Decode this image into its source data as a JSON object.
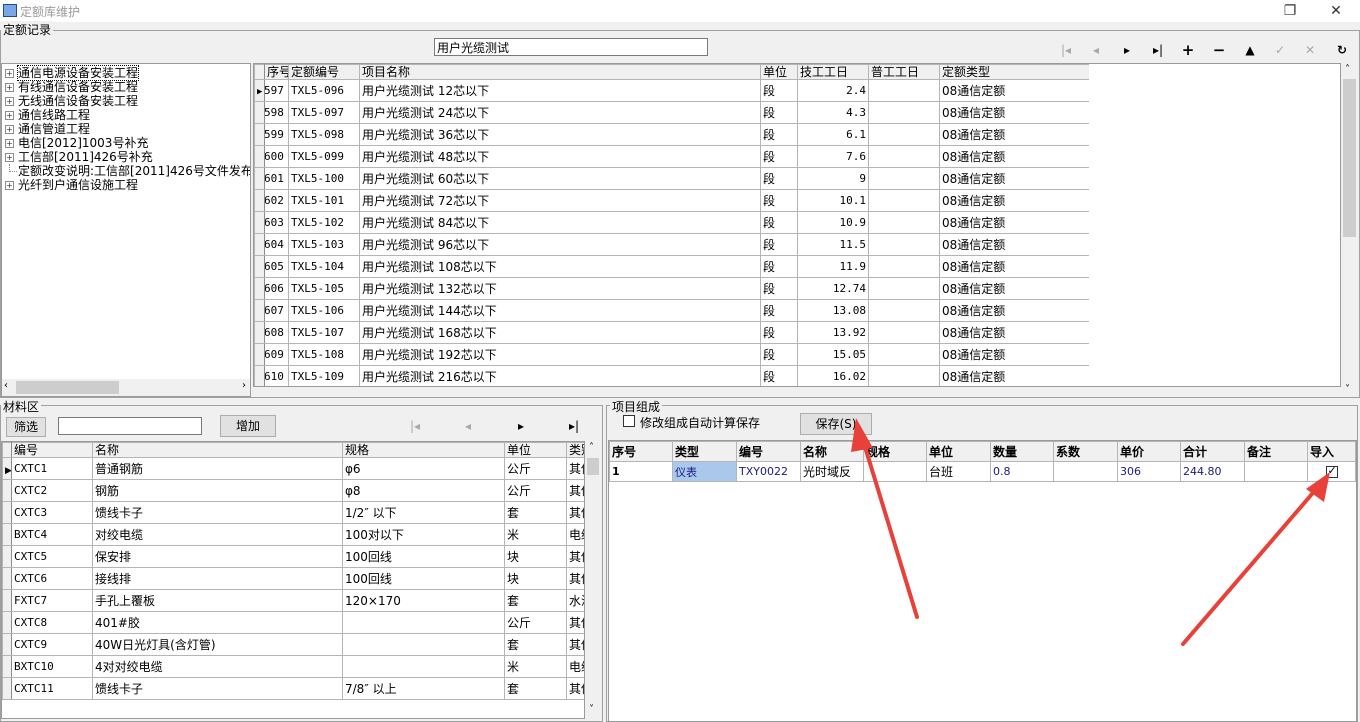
{
  "window": {
    "title": "定额库维护"
  },
  "quota": {
    "group_label": "定额记录",
    "search_value": "用户光缆测试",
    "tree": [
      {
        "label": "通信电源设备安装工程",
        "expander": "+"
      },
      {
        "label": "有线通信设备安装工程",
        "expander": "+"
      },
      {
        "label": "无线通信设备安装工程",
        "expander": "+"
      },
      {
        "label": "通信线路工程",
        "expander": "+"
      },
      {
        "label": "通信管道工程",
        "expander": "+"
      },
      {
        "label": "电信[2012]1003号补充",
        "expander": "+"
      },
      {
        "label": "工信部[2011]426号补充",
        "expander": "+"
      },
      {
        "label": "定额改变说明:工信部[2011]426号文件发布",
        "expander": ""
      },
      {
        "label": "光纤到户通信设施工程",
        "expander": "+"
      }
    ],
    "columns": [
      "序号",
      "定额编号",
      "项目名称",
      "单位",
      "技工工日",
      "普工工日",
      "定额类型"
    ],
    "rows": [
      {
        "seq": "597",
        "code": "TXL5-096",
        "name": "用户光缆测试 12芯以下",
        "unit": "段",
        "skilled": "2.4",
        "general": "",
        "type": "08通信定额"
      },
      {
        "seq": "598",
        "code": "TXL5-097",
        "name": "用户光缆测试 24芯以下",
        "unit": "段",
        "skilled": "4.3",
        "general": "",
        "type": "08通信定额"
      },
      {
        "seq": "599",
        "code": "TXL5-098",
        "name": "用户光缆测试 36芯以下",
        "unit": "段",
        "skilled": "6.1",
        "general": "",
        "type": "08通信定额"
      },
      {
        "seq": "600",
        "code": "TXL5-099",
        "name": "用户光缆测试 48芯以下",
        "unit": "段",
        "skilled": "7.6",
        "general": "",
        "type": "08通信定额"
      },
      {
        "seq": "601",
        "code": "TXL5-100",
        "name": "用户光缆测试 60芯以下",
        "unit": "段",
        "skilled": "9",
        "general": "",
        "type": "08通信定额"
      },
      {
        "seq": "602",
        "code": "TXL5-101",
        "name": "用户光缆测试 72芯以下",
        "unit": "段",
        "skilled": "10.1",
        "general": "",
        "type": "08通信定额"
      },
      {
        "seq": "603",
        "code": "TXL5-102",
        "name": "用户光缆测试 84芯以下",
        "unit": "段",
        "skilled": "10.9",
        "general": "",
        "type": "08通信定额"
      },
      {
        "seq": "604",
        "code": "TXL5-103",
        "name": "用户光缆测试 96芯以下",
        "unit": "段",
        "skilled": "11.5",
        "general": "",
        "type": "08通信定额"
      },
      {
        "seq": "605",
        "code": "TXL5-104",
        "name": "用户光缆测试 108芯以下",
        "unit": "段",
        "skilled": "11.9",
        "general": "",
        "type": "08通信定额"
      },
      {
        "seq": "606",
        "code": "TXL5-105",
        "name": "用户光缆测试 132芯以下",
        "unit": "段",
        "skilled": "12.74",
        "general": "",
        "type": "08通信定额"
      },
      {
        "seq": "607",
        "code": "TXL5-106",
        "name": "用户光缆测试 144芯以下",
        "unit": "段",
        "skilled": "13.08",
        "general": "",
        "type": "08通信定额"
      },
      {
        "seq": "608",
        "code": "TXL5-107",
        "name": "用户光缆测试 168芯以下",
        "unit": "段",
        "skilled": "13.92",
        "general": "",
        "type": "08通信定额"
      },
      {
        "seq": "609",
        "code": "TXL5-108",
        "name": "用户光缆测试 192芯以下",
        "unit": "段",
        "skilled": "15.05",
        "general": "",
        "type": "08通信定额"
      },
      {
        "seq": "610",
        "code": "TXL5-109",
        "name": "用户光缆测试 216芯以下",
        "unit": "段",
        "skilled": "16.02",
        "general": "",
        "type": "08通信定额"
      }
    ]
  },
  "material": {
    "group_label": "材料区",
    "filter_label": "筛选",
    "filter_value": "",
    "add_label": "增加",
    "columns": [
      "编号",
      "名称",
      "规格",
      "单位",
      "类别"
    ],
    "rows": [
      {
        "code": "CXTC1",
        "name": "普通钢筋",
        "spec": "φ6",
        "unit": "公斤",
        "cat": "其他"
      },
      {
        "code": "CXTC2",
        "name": "钢筋",
        "spec": "φ8",
        "unit": "公斤",
        "cat": "其他"
      },
      {
        "code": "CXTC3",
        "name": "馈线卡子",
        "spec": "1/2″ 以下",
        "unit": "套",
        "cat": "其他"
      },
      {
        "code": "BXTC4",
        "name": "对绞电缆",
        "spec": "100对以下",
        "unit": "米",
        "cat": "电缆"
      },
      {
        "code": "CXTC5",
        "name": "保安排",
        "spec": "100回线",
        "unit": "块",
        "cat": "其他"
      },
      {
        "code": "CXTC6",
        "name": "接线排",
        "spec": "100回线",
        "unit": "块",
        "cat": "其他"
      },
      {
        "code": "FXTC7",
        "name": "手孔上覆板",
        "spec": "120×170",
        "unit": "套",
        "cat": "水泥"
      },
      {
        "code": "CXTC8",
        "name": "401#胶",
        "spec": "",
        "unit": "公斤",
        "cat": "其他"
      },
      {
        "code": "CXTC9",
        "name": "40W日光灯具(含灯管)",
        "spec": "",
        "unit": "套",
        "cat": "其他"
      },
      {
        "code": "BXTC10",
        "name": "4对对绞电缆",
        "spec": "",
        "unit": "米",
        "cat": "电缆"
      },
      {
        "code": "CXTC11",
        "name": "馈线卡子",
        "spec": "7/8″ 以上",
        "unit": "套",
        "cat": "其他"
      }
    ]
  },
  "composition": {
    "group_label": "项目组成",
    "auto_save_label": "修改组成自动计算保存",
    "save_label": "保存(S)",
    "columns": [
      "序号",
      "类型",
      "编号",
      "名称",
      "规格",
      "单位",
      "数量",
      "系数",
      "单价",
      "合计",
      "备注",
      "导入"
    ],
    "rows": [
      {
        "seq": "1",
        "type": "仪表",
        "code": "TXY0022",
        "name": "光时域反",
        "spec": "",
        "unit": "台班",
        "qty": "0.8",
        "coef": "",
        "price": "306",
        "total": "244.80",
        "note": "",
        "imported": true
      }
    ]
  },
  "colors": {
    "arrow": "#e8413a",
    "selected_cell": "#a9c8ec"
  }
}
